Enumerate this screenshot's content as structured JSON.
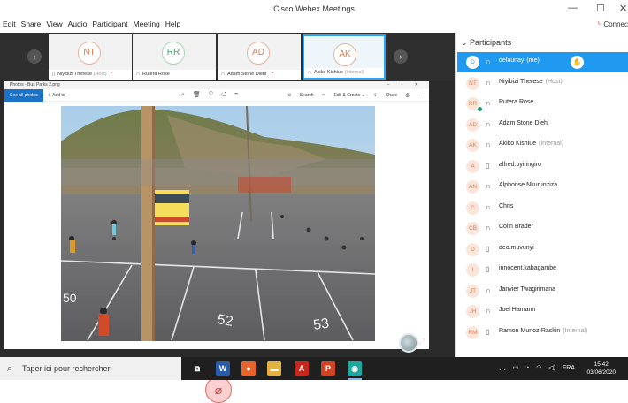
{
  "window": {
    "title": "Cisco Webex Meetings",
    "connection": "Connec"
  },
  "menu": [
    "Edit",
    "Share",
    "View",
    "Audio",
    "Participant",
    "Meeting",
    "Help"
  ],
  "thumbnails": [
    {
      "initials": "NT",
      "name": "Niyibizi Therese",
      "tag": "(Host)",
      "icon": "phone-icon",
      "muted": true,
      "active": false,
      "color": "orange"
    },
    {
      "initials": "RR",
      "name": "Rutera Rose",
      "tag": "",
      "icon": "headset-icon",
      "muted": false,
      "active": false,
      "color": "green"
    },
    {
      "initials": "AD",
      "name": "Adam Stone Diehl",
      "tag": "",
      "icon": "headset-icon",
      "muted": true,
      "active": false,
      "color": "orange"
    },
    {
      "initials": "AK",
      "name": "Akiko Kishiue",
      "tag": "(Internal)",
      "icon": "headset-icon",
      "muted": false,
      "active": true,
      "color": "orange"
    }
  ],
  "photos_app": {
    "title": "Photos - Bus Parks 2.png",
    "see_all": "See all photos",
    "add_to": "Add to",
    "search": "Search",
    "edit_create": "Edit & Create",
    "share": "Share"
  },
  "photo_labels": [
    "52",
    "53",
    "50"
  ],
  "participants_panel": {
    "header": "Participants",
    "items": [
      {
        "initials": "D",
        "name": "delaunay",
        "tag": "(me)",
        "icon": "headset-icon",
        "selected": true,
        "hand": true
      },
      {
        "initials": "NT",
        "name": "Niyibizi Therese",
        "tag": "(Host)",
        "icon": "headset-icon"
      },
      {
        "initials": "RR",
        "name": "Rutera Rose",
        "tag": "",
        "icon": "headset-icon",
        "presenter": true
      },
      {
        "initials": "AD",
        "name": "Adam Stone Diehl",
        "tag": "",
        "icon": "headset-icon"
      },
      {
        "initials": "AK",
        "name": "Akiko Kishiue",
        "tag": "(Internal)",
        "icon": "headset-icon"
      },
      {
        "initials": "A",
        "name": "alfred.byiringiro",
        "tag": "",
        "icon": "phone-icon"
      },
      {
        "initials": "AN",
        "name": "Alphonse Nkurunziza",
        "tag": "",
        "icon": "headset-icon"
      },
      {
        "initials": "C",
        "name": "Chris",
        "tag": "",
        "icon": "headset-icon"
      },
      {
        "initials": "CB",
        "name": "Colin Brader",
        "tag": "",
        "icon": "headset-icon"
      },
      {
        "initials": "D",
        "name": "deo.muvunyi",
        "tag": "",
        "icon": "phone-icon"
      },
      {
        "initials": "I",
        "name": "innocent.kabagambe",
        "tag": "",
        "icon": "phone-icon"
      },
      {
        "initials": "JT",
        "name": "Janvier Twagirimana",
        "tag": "",
        "icon": "headset-icon"
      },
      {
        "initials": "JH",
        "name": "Joel Hamann",
        "tag": "",
        "icon": "headset-icon"
      },
      {
        "initials": "RM",
        "name": "Ramon Munoz-Raskin",
        "tag": "(Internal)",
        "icon": "phone-icon"
      }
    ]
  },
  "taskbar": {
    "search_placeholder": "Taper ici pour rechercher",
    "apps": [
      {
        "name": "task-view-icon",
        "label": "⧉",
        "bg": "transparent"
      },
      {
        "name": "word-icon",
        "label": "W",
        "bg": "#2b5aa8"
      },
      {
        "name": "firefox-icon",
        "label": "●",
        "bg": "#e8642a"
      },
      {
        "name": "file-explorer-icon",
        "label": "▬",
        "bg": "#e3b341"
      },
      {
        "name": "acrobat-icon",
        "label": "A",
        "bg": "#c9261d"
      },
      {
        "name": "powerpoint-icon",
        "label": "P",
        "bg": "#d04423"
      },
      {
        "name": "webex-icon",
        "label": "◉",
        "bg": "#1ba9a0"
      }
    ],
    "language": "FRA",
    "time": "15:42",
    "date": "03/06/2020"
  },
  "colors": {
    "accent": "#1f9af0",
    "mute": "#d9352a",
    "stage": "#2b2b2b"
  }
}
